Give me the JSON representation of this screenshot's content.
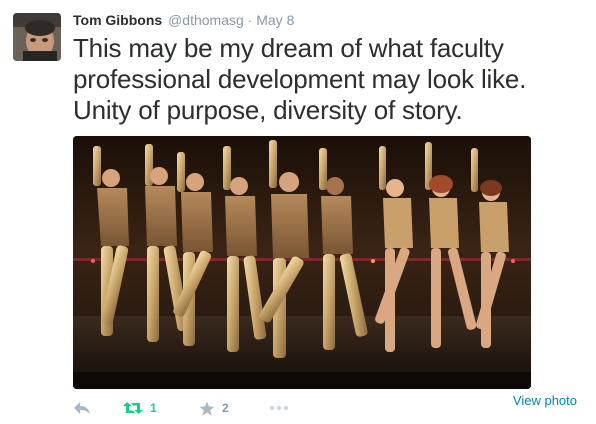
{
  "author": {
    "fullname": "Tom Gibbons",
    "handle": "@dthomasg",
    "separator": "·",
    "timestamp": "May 8"
  },
  "tweet": {
    "text": "This may be my dream of what faculty professional development may look like. Unity of purpose, diversity of story."
  },
  "media": {
    "description_icon": "photo-of-chorus-line-dancers"
  },
  "actions": {
    "reply_icon": "reply-icon",
    "retweet_icon": "retweet-icon",
    "retweet_count": "1",
    "favorite_icon": "star-icon",
    "favorite_count": "2",
    "more_icon": "more-dots-icon",
    "view_photo_label": "View photo"
  },
  "colors": {
    "text": "#292f33",
    "muted": "#8899a6",
    "link": "#0084b4",
    "retweet_active": "#19cf86"
  }
}
